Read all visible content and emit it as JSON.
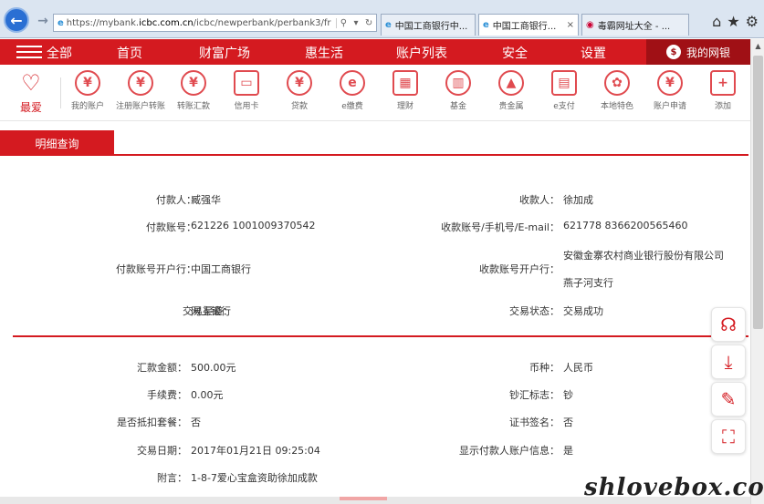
{
  "browser": {
    "url_prefix": "https://mybank.",
    "url_domain": "icbc.com.cn",
    "url_rest": "/icbc/newperbank/perbank3/fr",
    "tabs": [
      {
        "title": "中国工商银行中..."
      },
      {
        "title": "中国工商银行...",
        "close": "×"
      },
      {
        "title": "毒霸网址大全 - ..."
      }
    ]
  },
  "topnav": {
    "all": "全部",
    "items": [
      "首页",
      "财富广场",
      "惠生活",
      "账户列表",
      "安全",
      "设置"
    ],
    "mybank": "我的网银"
  },
  "iconbar": {
    "fav": "最爱",
    "items": [
      {
        "label": "我的账户",
        "glyph": "¥"
      },
      {
        "label": "注册账户转账",
        "glyph": "¥"
      },
      {
        "label": "转账汇款",
        "glyph": "¥"
      },
      {
        "label": "信用卡",
        "glyph": "▭"
      },
      {
        "label": "贷款",
        "glyph": "¥"
      },
      {
        "label": "e缴费",
        "glyph": "e"
      },
      {
        "label": "理财",
        "glyph": "▦"
      },
      {
        "label": "基金",
        "glyph": "▥"
      },
      {
        "label": "贵金属",
        "glyph": "▲"
      },
      {
        "label": "e支付",
        "glyph": "▤"
      },
      {
        "label": "本地特色",
        "glyph": "✿"
      },
      {
        "label": "账户申请",
        "glyph": "¥"
      },
      {
        "label": "添加",
        "glyph": "+"
      }
    ]
  },
  "subtab": "明细查询",
  "detail": {
    "payer_label": "付款人：",
    "payer": "臧强华",
    "payee_label": "收款人：",
    "payee": "徐加成",
    "payer_acct_label": "付款账号：",
    "payer_acct": "621226 1001009370542",
    "payee_acct_label": "收款账号/手机号/E-mail：",
    "payee_acct": "621778 8366200565460",
    "payer_bank_label": "付款账号开户行：",
    "payer_bank": "中国工商银行",
    "payee_bank_label": "收款账号开户行：",
    "payee_bank_line1": "安徽金寨农村商业银行股份有限公司",
    "payee_bank_line2": "燕子河支行",
    "channel_label": "交易渠道：",
    "channel": "网上银行",
    "status_label": "交易状态：",
    "status": "交易成功",
    "amount_label": "汇款金额：",
    "amount": "500.00元",
    "currency_label": "币种：",
    "currency": "人民币",
    "fee_label": "手续费：",
    "fee": "0.00元",
    "cash_label": "钞汇标志：",
    "cash": "钞",
    "package_label": "是否抵扣套餐：",
    "package": "否",
    "cert_label": "证书签名：",
    "cert": "否",
    "date_label": "交易日期：",
    "date": "2017年01月21日 09:25:04",
    "show_payer_label": "显示付款人账户信息：",
    "show_payer": "是",
    "note_label": "附言：",
    "note": "1-8-7爱心宝盒资助徐加成款"
  },
  "watermark": "shlovebox.com",
  "colors": {
    "brand": "#d41a20",
    "brand_dark": "#a01015"
  }
}
